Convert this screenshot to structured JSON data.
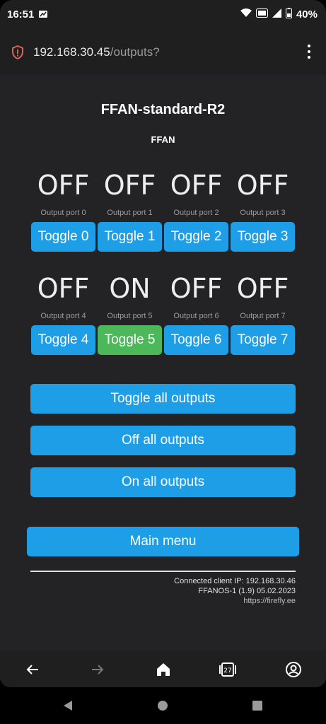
{
  "status_bar": {
    "time": "16:51",
    "battery": "40%",
    "icons": [
      "image-icon",
      "wifi-icon",
      "volte-icon",
      "signal-icon",
      "battery-icon"
    ]
  },
  "browser": {
    "url_host": "192.168.30.45",
    "url_path": "/outputs?",
    "security_icon": "shield-alert-icon",
    "menu_icon": "kebab-icon"
  },
  "page": {
    "title": "FFAN-standard-R2",
    "subtitle": "FFAN",
    "ports": [
      {
        "state": "OFF",
        "label": "Output port 0",
        "button": "Toggle 0",
        "on": false
      },
      {
        "state": "OFF",
        "label": "Output port 1",
        "button": "Toggle 1",
        "on": false
      },
      {
        "state": "OFF",
        "label": "Output port 2",
        "button": "Toggle 2",
        "on": false
      },
      {
        "state": "OFF",
        "label": "Output port 3",
        "button": "Toggle 3",
        "on": false
      },
      {
        "state": "OFF",
        "label": "Output port 4",
        "button": "Toggle 4",
        "on": false
      },
      {
        "state": "ON",
        "label": "Output port 5",
        "button": "Toggle 5",
        "on": true
      },
      {
        "state": "OFF",
        "label": "Output port 6",
        "button": "Toggle 6",
        "on": false
      },
      {
        "state": "OFF",
        "label": "Output port 7",
        "button": "Toggle 7",
        "on": false
      }
    ],
    "toggle_all": "Toggle all outputs",
    "off_all": "Off all outputs",
    "on_all": "On all outputs",
    "main_menu": "Main menu",
    "footer": {
      "client_ip": "Connected client IP: 192.168.30.46",
      "version": "FFANOS-1 (1.9) 05.02.2023",
      "link": "https://firefly.ee"
    }
  },
  "browser_nav": {
    "tab_count": "27"
  },
  "colors": {
    "button_blue": "#1f9ee8",
    "button_green": "#4cb85a",
    "page_bg": "#232325",
    "chrome_bg": "#1f1f1f"
  }
}
